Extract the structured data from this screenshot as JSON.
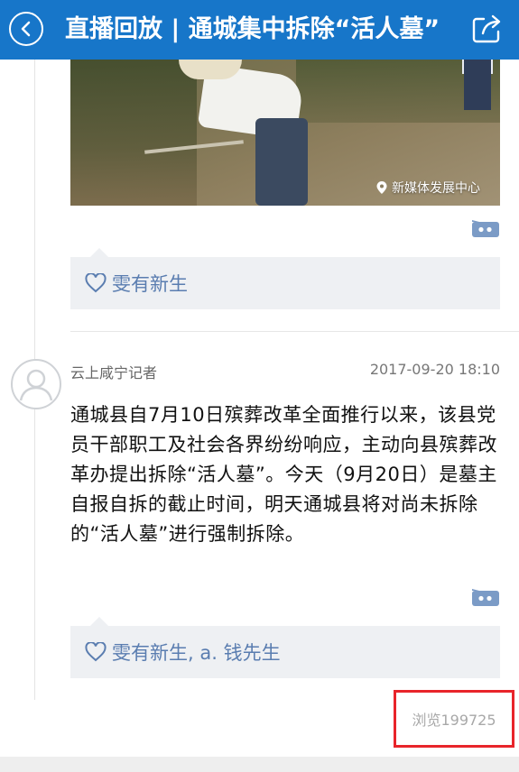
{
  "header": {
    "title": "直播回放 | 通城集中拆除“活人墓”",
    "colors": {
      "background": "#1776c9",
      "text": "#ffffff"
    },
    "icons": {
      "back": "chevron-left-icon",
      "share": "share-icon"
    }
  },
  "posts": [
    {
      "photo": {
        "watermark": "新媒体发展中心",
        "watermark_icon": "location-pin-icon"
      },
      "likes": "雯有新生"
    },
    {
      "author": "云上咸宁记者",
      "timestamp": "2017-09-20 18:10",
      "text": "通城县自7月10日殡葬改革全面推行以来，该县党员干部职工及社会各界纷纷响应，主动向县殡葬改革办提出拆除“活人墓”。今天（9月20日）是墓主自报自拆的截止时间，明天通城县将对尚未拆除的“活人墓”进行强制拆除。",
      "likes": "雯有新生, a. 钱先生"
    }
  ],
  "views_label": "浏览199725",
  "colors": {
    "like_text": "#5a7db0",
    "highlight_border": "#e8242a",
    "comment_icon": "#7b9bc6"
  }
}
